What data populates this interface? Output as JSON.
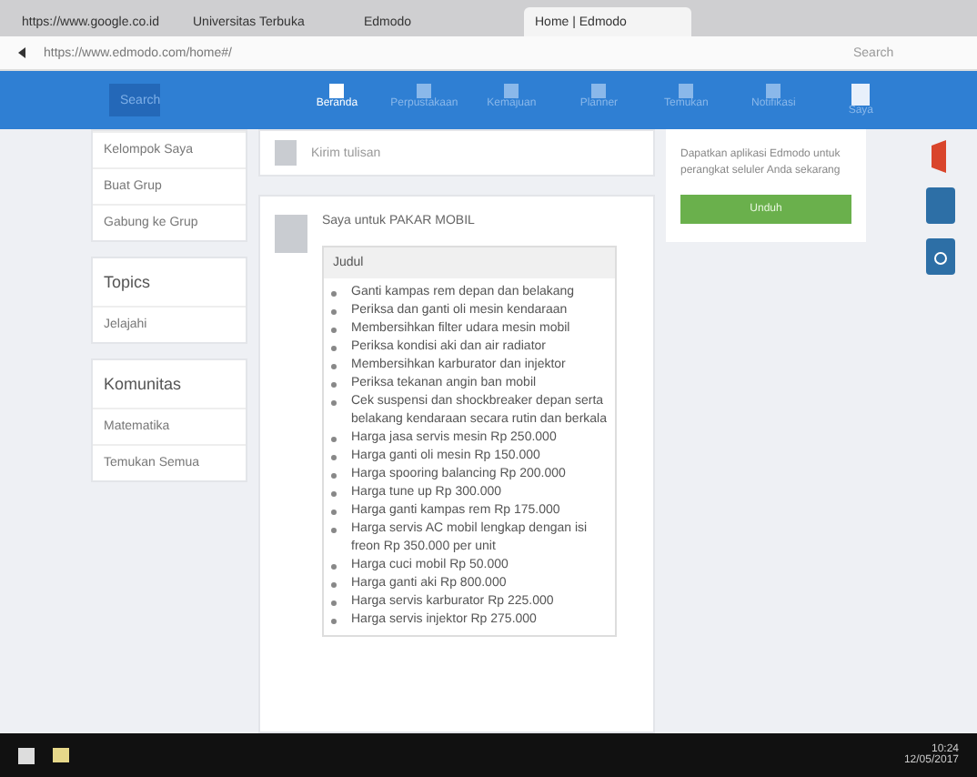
{
  "browser": {
    "tabs": [
      {
        "label": "https://www.google.co.id",
        "selected": false
      },
      {
        "label": "Universitas Terbuka",
        "selected": false
      },
      {
        "label": "Edmodo",
        "selected": false
      },
      {
        "label": "Home | Edmodo",
        "selected": true
      }
    ],
    "address": "https://www.edmodo.com/home#/",
    "search_placeholder": "Search"
  },
  "nav": {
    "search_placeholder": "Search",
    "items": [
      {
        "label": "Beranda",
        "selected": true
      },
      {
        "label": "Perpustakaan",
        "selected": false
      },
      {
        "label": "Kemajuan",
        "selected": false
      },
      {
        "label": "Planner",
        "selected": false
      },
      {
        "label": "Temukan",
        "selected": false
      },
      {
        "label": "Notifikasi",
        "selected": false
      }
    ],
    "user": "Saya"
  },
  "sidebar": {
    "groups": [
      {
        "items": [
          "Kelompok Saya",
          "Buat Grup",
          "Gabung ke Grup"
        ]
      },
      {
        "title": "Topics",
        "items": [
          "Jelajahi"
        ]
      },
      {
        "title": "Komunitas",
        "items": [
          "Matematika",
          "Temukan Semua"
        ]
      }
    ]
  },
  "composer": {
    "placeholder": "Kirim tulisan"
  },
  "post": {
    "author": "Saya untuk PAKAR MOBIL",
    "title": "Judul",
    "items": [
      "Ganti kampas rem depan dan belakang",
      "Periksa dan ganti oli mesin kendaraan",
      "Membersihkan filter udara mesin mobil",
      "Periksa kondisi aki dan air radiator",
      "Membersihkan karburator dan injektor",
      "Periksa tekanan angin ban mobil",
      "Cek suspensi dan shockbreaker depan serta belakang kendaraan secara rutin dan berkala",
      "Harga jasa servis mesin Rp 250.000",
      "Harga ganti oli mesin Rp 150.000",
      "Harga spooring balancing Rp 200.000",
      "Harga tune up Rp 300.000",
      "Harga ganti kampas rem Rp 175.000",
      "Harga servis AC mobil lengkap dengan isi freon Rp 350.000 per unit",
      "Harga cuci mobil Rp 50.000",
      "Harga ganti aki Rp 800.000",
      "Harga servis karburator Rp 225.000",
      "Harga servis injektor Rp 275.000"
    ]
  },
  "promo": {
    "text": "Dapatkan aplikasi Edmodo untuk perangkat seluler Anda sekarang",
    "button": "Unduh"
  },
  "taskbar": {
    "time": "10:24",
    "date": "12/05/2017"
  }
}
